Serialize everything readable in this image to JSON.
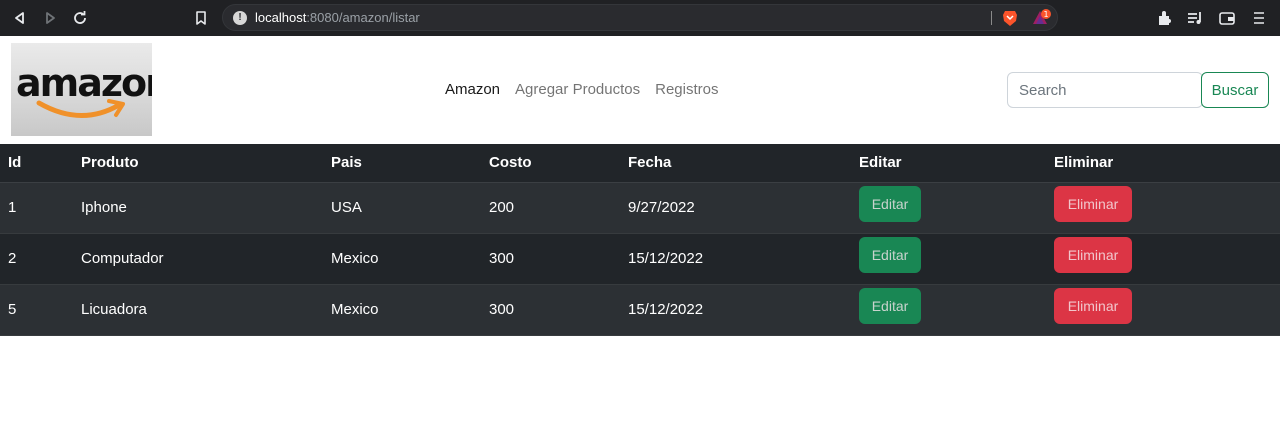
{
  "browser": {
    "url_host": "localhost",
    "url_path": ":8080/amazon/listar",
    "rewards_count": "1"
  },
  "navbar": {
    "logo_text": "amazon",
    "links": [
      "Amazon",
      "Agregar Productos",
      "Registros"
    ],
    "search_placeholder": "Search",
    "search_button": "Buscar"
  },
  "table": {
    "headers": [
      "Id",
      "Produto",
      "Pais",
      "Costo",
      "Fecha",
      "Editar",
      "Eliminar"
    ],
    "rows": [
      {
        "id": "1",
        "produto": "Iphone",
        "pais": "USA",
        "costo": "200",
        "fecha": "9/27/2022",
        "edit_label": "Editar",
        "delete_label": "Eliminar"
      },
      {
        "id": "2",
        "produto": "Computador",
        "pais": "Mexico",
        "costo": "300",
        "fecha": "15/12/2022",
        "edit_label": "Editar",
        "delete_label": "Eliminar"
      },
      {
        "id": "5",
        "produto": "Licuadora",
        "pais": "Mexico",
        "costo": "300",
        "fecha": "15/12/2022",
        "edit_label": "Editar",
        "delete_label": "Eliminar"
      }
    ]
  },
  "colors": {
    "table_dark": "#212529",
    "table_stripe": "#2c3034",
    "edit_green": "#198754",
    "delete_red": "#dc3545"
  }
}
